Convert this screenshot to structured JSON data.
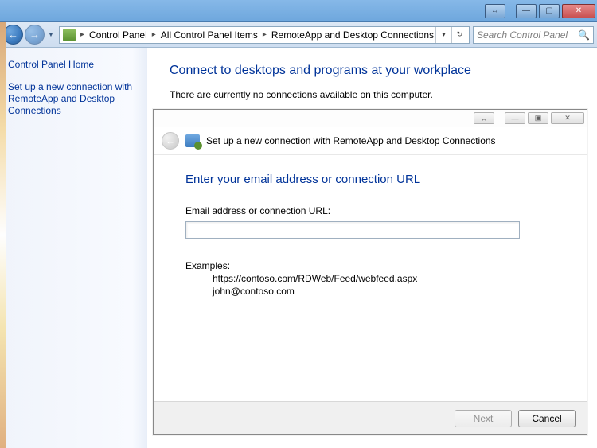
{
  "titlebar": {
    "expand_glyph": "↔",
    "min_glyph": "—",
    "max_glyph": "▢",
    "close_glyph": "✕"
  },
  "breadcrumb": {
    "items": [
      "Control Panel",
      "All Control Panel Items",
      "RemoteApp and Desktop Connections"
    ],
    "dropdown_glyph": "▾",
    "refresh_glyph": "↻"
  },
  "search": {
    "placeholder": "Search Control Panel",
    "mag_glyph": "🔍"
  },
  "sidebar": {
    "home": "Control Panel Home",
    "link": "Set up a new connection with RemoteApp and Desktop Connections"
  },
  "main": {
    "title": "Connect to desktops and programs at your workplace",
    "text": "There are currently no connections available on this computer."
  },
  "dialog": {
    "titlebar": {
      "expand_glyph": "↔",
      "min_glyph": "—",
      "max_glyph": "▣",
      "close_glyph": "✕"
    },
    "header": "Set up a new connection with RemoteApp and Desktop Connections",
    "title": "Enter your email address or connection URL",
    "field_label": "Email address or connection URL:",
    "field_value": "",
    "examples_label": "Examples:",
    "example1": "https://contoso.com/RDWeb/Feed/webfeed.aspx",
    "example2": "john@contoso.com",
    "next_label": "Next",
    "cancel_label": "Cancel"
  }
}
